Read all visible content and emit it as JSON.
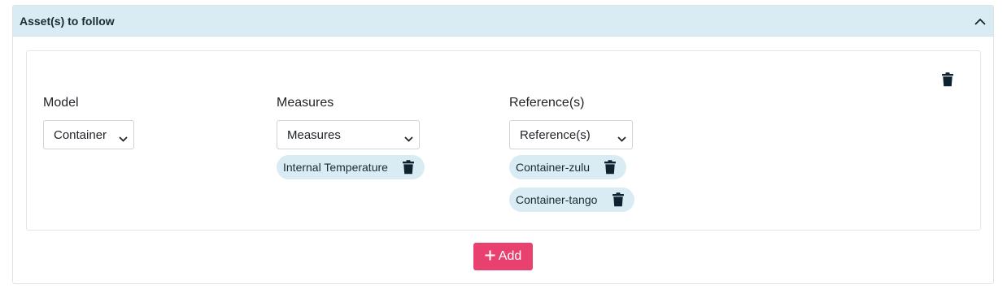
{
  "panel": {
    "title": "Asset(s) to follow",
    "toggle_icon": "chevron-up-icon"
  },
  "card": {
    "delete_icon": "trash-icon",
    "model": {
      "label": "Model",
      "selected": "Container"
    },
    "measures": {
      "label": "Measures",
      "selected": "Measures",
      "chips": [
        {
          "label": "Internal Temperature"
        }
      ]
    },
    "references": {
      "label": "Reference(s)",
      "selected": "Reference(s)",
      "chips": [
        {
          "label": "Container-zulu"
        },
        {
          "label": "Container-tango"
        }
      ]
    }
  },
  "add_button": {
    "icon": "plus-icon",
    "label": "Add"
  },
  "colors": {
    "header_bg": "#d9ecf4",
    "chip_bg": "#d9ecf4",
    "accent": "#e8416f",
    "icon": "#0f2230"
  }
}
